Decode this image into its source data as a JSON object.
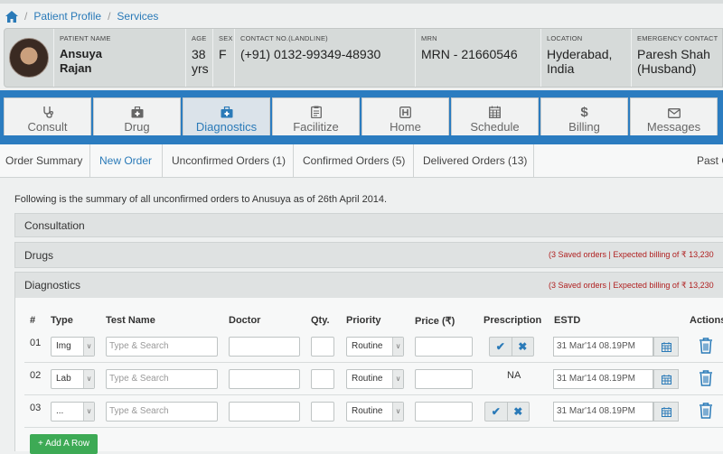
{
  "breadcrumb": {
    "items": [
      "Patient Profile",
      "Services"
    ]
  },
  "patient": {
    "name_label": "PATIENT NAME",
    "name_line1": "Ansuya",
    "name_line2": "Rajan",
    "age_label": "AGE",
    "age_line1": "38",
    "age_line2": "yrs",
    "sex_label": "SEX",
    "sex": "F",
    "contact_label": "CONTACT NO.(Landline)",
    "contact": "(+91) 0132-99349-48930",
    "mrn_label": "MRN",
    "mrn": "MRN - 21660546",
    "location_label": "LOCATION",
    "location_line1": "Hyderabad,",
    "location_line2": "India",
    "emergency_label": "EMERGENCY CONTACT",
    "emergency_line1": "Paresh Shah",
    "emergency_line2": "(Husband)"
  },
  "tabs": [
    {
      "label": "Consult",
      "icon": "stethoscope-icon"
    },
    {
      "label": "Drug",
      "icon": "medkit-icon"
    },
    {
      "label": "Diagnostics",
      "icon": "medkit-icon",
      "active": true
    },
    {
      "label": "Facilitize",
      "icon": "clipboard-icon"
    },
    {
      "label": "Home",
      "icon": "hospital-icon"
    },
    {
      "label": "Schedule",
      "icon": "calendar-icon"
    },
    {
      "label": "Billing",
      "icon": "dollar-icon"
    },
    {
      "label": "Messages",
      "icon": "envelope-icon"
    }
  ],
  "subnav": [
    "Order Summary",
    "New Order",
    "Unconfirmed Orders (1)",
    "Confirmed Orders (5)",
    "Delivered Orders (13)",
    "Past O"
  ],
  "summary_text": "Following is the summary of all unconfirmed orders to Anusuya as of 26th April 2014.",
  "sections": {
    "consultation": "Consultation",
    "drugs": "Drugs",
    "drugs_info": "(3 Saved orders | Expected billing of ₹ 13,230",
    "diagnostics": "Diagnostics",
    "diagnostics_info": "(3 Saved orders | Expected billing of ₹ 13,230"
  },
  "table": {
    "headers": [
      "#",
      "Type",
      "Test Name",
      "Doctor",
      "Qty.",
      "Priority",
      "Price (₹)",
      "Prescription",
      "ESTD",
      "Actions"
    ],
    "placeholder": "Type & Search",
    "rows": [
      {
        "num": "01",
        "type": "Img",
        "priority": "Routine",
        "prescription": "buttons",
        "estd": "31 Mar'14 08.19PM"
      },
      {
        "num": "02",
        "type": "Lab",
        "priority": "Routine",
        "prescription": "NA",
        "estd": "31 Mar'14 08.19PM"
      },
      {
        "num": "03",
        "type": "...",
        "priority": "Routine",
        "prescription": "buttons",
        "estd": "31 Mar'14 08.19PM"
      }
    ]
  },
  "add_row_label": "+ Add A Row",
  "colors": {
    "accent": "#2b7cc0",
    "alert": "#b02020",
    "success": "#3daa55"
  }
}
